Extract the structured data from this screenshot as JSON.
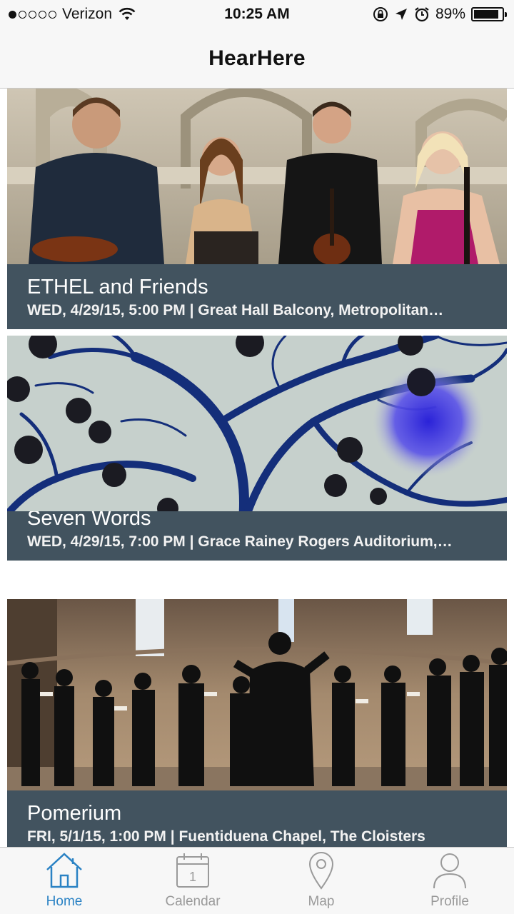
{
  "status_bar": {
    "carrier": "Verizon",
    "time": "10:25 AM",
    "battery": "89%",
    "battery_level": 0.89,
    "signal_bars_filled": 1,
    "signal_bars_total": 5
  },
  "nav": {
    "title": "HearHere"
  },
  "events": [
    {
      "title": "ETHEL and Friends",
      "subtitle": "WED, 4/29/15, 5:00 PM | Great Hall Balcony, Metropolitan…"
    },
    {
      "title": "Seven Words",
      "subtitle": "WED, 4/29/15, 7:00 PM | Grace Rainey Rogers Auditorium,…"
    },
    {
      "title": "Pomerium",
      "subtitle": "FRI, 5/1/15, 1:00 PM | Fuentiduena Chapel, The Cloisters"
    }
  ],
  "tabs": [
    {
      "label": "Home",
      "icon": "home-icon",
      "active": true
    },
    {
      "label": "Calendar",
      "icon": "calendar-icon",
      "calendar_day": "1",
      "active": false
    },
    {
      "label": "Map",
      "icon": "map-pin-icon",
      "active": false
    },
    {
      "label": "Profile",
      "icon": "person-icon",
      "active": false
    }
  ],
  "colors": {
    "card_info_bg": "#42535f",
    "tab_active": "#2a82c4",
    "tab_inactive": "#9a9a9a"
  }
}
